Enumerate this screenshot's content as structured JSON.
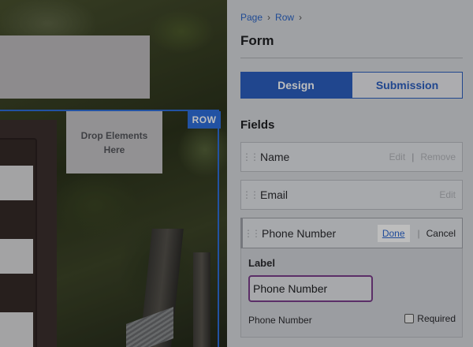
{
  "canvas": {
    "drop_zone_text": "Drop Elements Here",
    "row_badge": "ROW"
  },
  "panel": {
    "breadcrumb": [
      "Page",
      "Row"
    ],
    "title": "Form",
    "tabs": [
      {
        "label": "Design",
        "active": true
      },
      {
        "label": "Submission",
        "active": false
      }
    ],
    "section_title": "Fields",
    "fields": [
      {
        "label": "Name",
        "actions": [
          "Edit",
          "Remove"
        ]
      },
      {
        "label": "Email",
        "actions": [
          "Edit"
        ]
      },
      {
        "label": "Phone Number",
        "actions": [
          "Done",
          "Cancel"
        ]
      }
    ],
    "editor": {
      "label_heading": "Label",
      "label_value": "Phone Number",
      "footer_text": "Phone Number",
      "required_label": "Required",
      "required_checked": false
    }
  },
  "colors": {
    "accent": "#2c5fc0",
    "row_outline": "#2f6fdc",
    "input_focus": "#7b3f8b"
  }
}
